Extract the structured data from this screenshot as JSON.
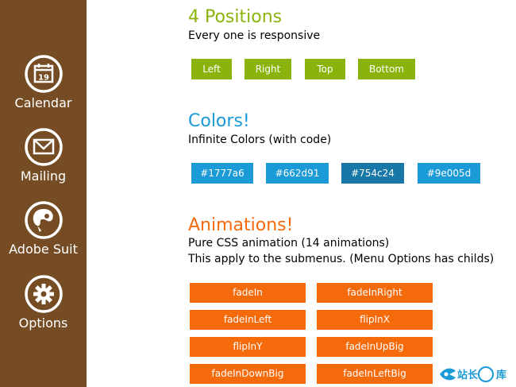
{
  "colors": {
    "sidebar": "#754c24",
    "green": "#8ab40b",
    "blue": "#1a9ad6",
    "orange": "#f56a0b"
  },
  "sidebar": {
    "items": [
      {
        "label": "Calendar",
        "icon": "calendar-icon",
        "badge": "19"
      },
      {
        "label": "Mailing",
        "icon": "mail-icon"
      },
      {
        "label": "Adobe Suit",
        "icon": "palette-icon"
      },
      {
        "label": "Options",
        "icon": "gear-icon"
      }
    ]
  },
  "positions": {
    "title": "4 Positions",
    "subtitle": "Every one is responsive",
    "buttons": [
      "Left",
      "Right",
      "Top",
      "Bottom"
    ]
  },
  "colors_section": {
    "title": "Colors!",
    "subtitle": "Infinite Colors (with code)",
    "buttons": [
      "#1777a6",
      "#662d91",
      "#754c24",
      "#9e005d"
    ]
  },
  "animations": {
    "title": "Animations!",
    "subtitle_line1": "Pure CSS animation (14 animations)",
    "subtitle_line2": "This apply to the submenus. (Menu Options has childs)",
    "buttons": [
      "fadeIn",
      "fadeInRight",
      "fadeInLeft",
      "flipInX",
      "flipInY",
      "fadeInUpBig",
      "fadeInDownBig",
      "fadeInLeftBig"
    ]
  },
  "watermark": {
    "text": "站长之库"
  }
}
